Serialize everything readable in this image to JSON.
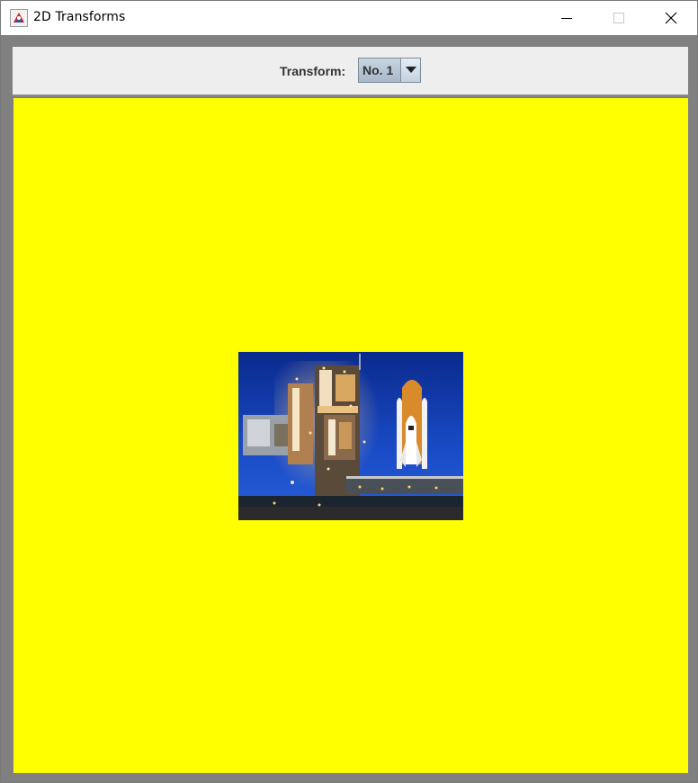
{
  "window": {
    "title": "2D Transforms",
    "colors": {
      "frame": "#808080",
      "canvas": "#ffff00",
      "toolbar": "#eeeeee"
    }
  },
  "toolbar": {
    "transform_label": "Transform:",
    "transform_select": {
      "selected": "No. 1"
    }
  },
  "canvas": {
    "image": {
      "subject": "space shuttle on launch pad at night",
      "icon": "photo-icon"
    }
  }
}
